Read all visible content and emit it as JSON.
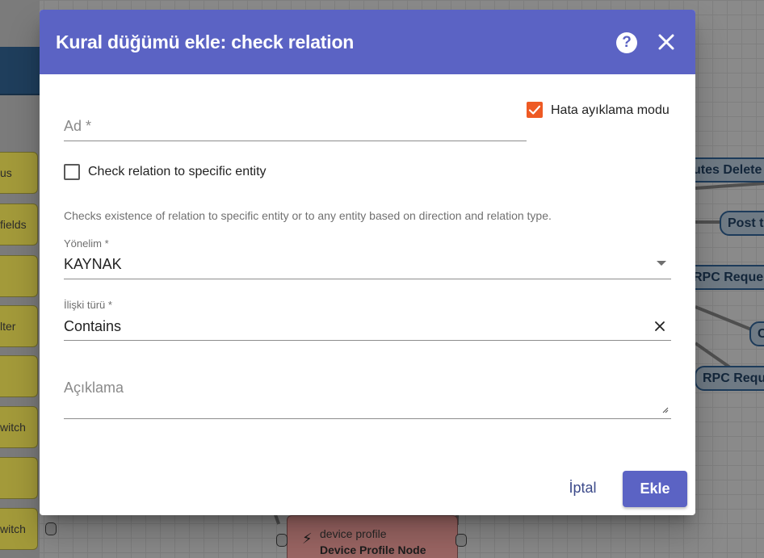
{
  "dialog": {
    "title": "Kural düğümü ekle: check relation",
    "help_glyph": "?",
    "name_placeholder": "Ad *",
    "debug_label": "Hata ayıklama modu",
    "debug_checked": true,
    "check_specific_label": "Check relation to specific entity",
    "check_specific_checked": false,
    "hint": "Checks existence of relation to specific entity or to any entity based on direction and relation type.",
    "direction_label": "Yönelim *",
    "direction_value": "KAYNAK",
    "relation_type_label": "İlişki türü *",
    "relation_type_value": "Contains",
    "description_placeholder": "Açıklama",
    "cancel_label": "İptal",
    "add_label": "Ekle",
    "accent_color": "#5b63c4",
    "checkbox_color": "#ee5a24"
  },
  "canvas": {
    "left_nodes": [
      "us",
      "fields",
      "",
      "lter",
      "",
      "witch",
      "",
      "witch"
    ],
    "right_nodes": [
      "utes Delete",
      "Post t",
      "RPC Reque",
      "C",
      "RPC Requ"
    ],
    "device_node": {
      "type": "device profile",
      "name": "Device Profile Node"
    }
  }
}
